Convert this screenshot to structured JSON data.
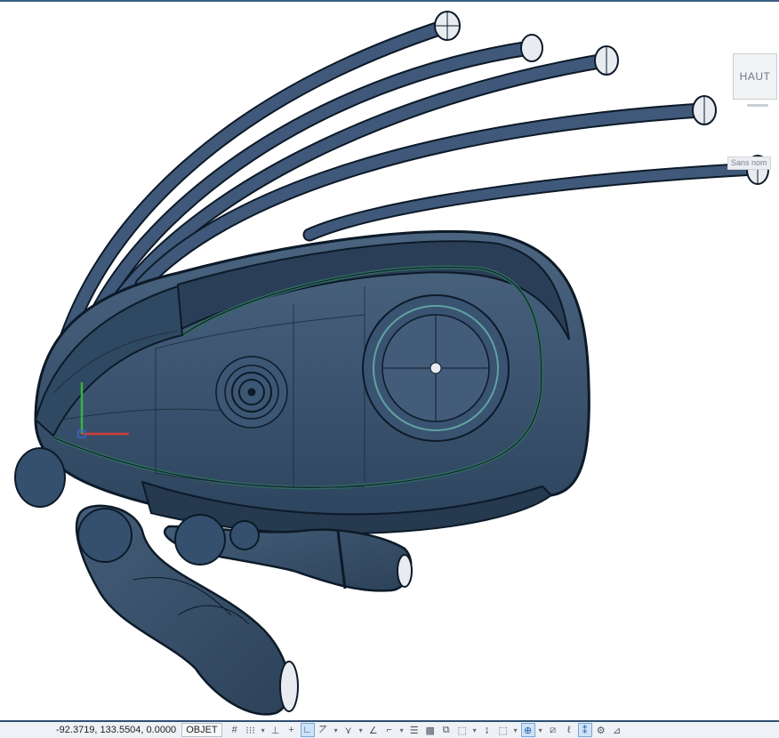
{
  "viewcube": {
    "label": "HAUT"
  },
  "named_view": {
    "label": "Sans nom"
  },
  "statusbar": {
    "coordinates": "-92.3719, 133.5504, 0.0000",
    "model_label": "OBJET",
    "tools": [
      {
        "icon": "grid-display-icon",
        "glyph": "#"
      },
      {
        "icon": "snap-mode-icon",
        "glyph": "⁝⁝⁝"
      },
      {
        "icon": "chevron-down-icon",
        "glyph": "▾"
      },
      {
        "icon": "infer-constraints-icon",
        "glyph": "⊥"
      },
      {
        "icon": "dynamic-input-icon",
        "glyph": "+"
      },
      {
        "icon": "ortho-mode-icon",
        "glyph": "∟",
        "active": true
      },
      {
        "icon": "polar-tracking-icon",
        "glyph": "⦢"
      },
      {
        "icon": "chevron-down-icon",
        "glyph": "▾"
      },
      {
        "icon": "isometric-drafting-icon",
        "glyph": "⋎"
      },
      {
        "icon": "chevron-down-icon",
        "glyph": "▾"
      },
      {
        "icon": "object-snap-tracking-icon",
        "glyph": "∠"
      },
      {
        "icon": "object-snap-icon",
        "glyph": "⌐"
      },
      {
        "icon": "chevron-down-icon",
        "glyph": "▾"
      },
      {
        "icon": "lineweight-icon",
        "glyph": "☰"
      },
      {
        "icon": "transparency-icon",
        "glyph": "▩"
      },
      {
        "icon": "selection-cycling-icon",
        "glyph": "⧉"
      },
      {
        "icon": "3d-object-snap-icon",
        "glyph": "⬚"
      },
      {
        "icon": "chevron-down-icon",
        "glyph": "▾"
      },
      {
        "icon": "dynamic-ucs-icon",
        "glyph": "↨"
      },
      {
        "icon": "selection-filter-icon",
        "glyph": "⬚"
      },
      {
        "icon": "chevron-down-icon",
        "glyph": "▾"
      },
      {
        "icon": "gizmo-icon",
        "glyph": "⊕",
        "active": true
      },
      {
        "icon": "chevron-down-icon",
        "glyph": "▾"
      },
      {
        "icon": "annotation-visibility-icon",
        "glyph": "⧄"
      },
      {
        "icon": "auto-scale-icon",
        "glyph": "ℓ"
      },
      {
        "icon": "annotation-scale-icon",
        "glyph": "⁑",
        "active": true
      },
      {
        "icon": "workspace-switching-icon",
        "glyph": "⚙"
      },
      {
        "icon": "annotation-monitor-icon",
        "glyph": "⊿"
      }
    ]
  },
  "colors": {
    "body": "#3f5873",
    "body_dark": "#243a52",
    "edge": "#0d1a28",
    "accent_green": "#2f6b5e",
    "status_border": "#2f4f72"
  }
}
